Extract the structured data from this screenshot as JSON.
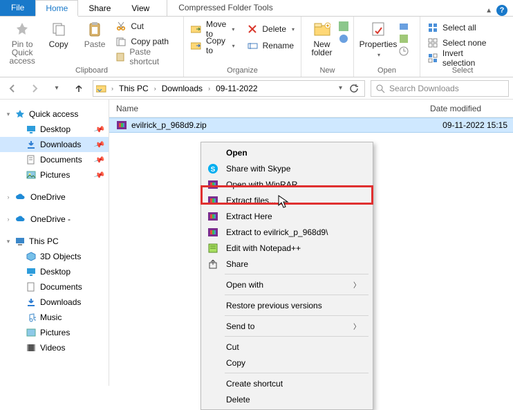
{
  "tabs": {
    "file": "File",
    "home": "Home",
    "share": "Share",
    "view": "View",
    "tools": "Compressed Folder Tools"
  },
  "ribbon": {
    "clipboard": {
      "label": "Clipboard",
      "pin": "Pin to Quick access",
      "copy": "Copy",
      "paste": "Paste",
      "cut": "Cut",
      "copy_path": "Copy path",
      "paste_shortcut": "Paste shortcut"
    },
    "organize": {
      "label": "Organize",
      "move_to": "Move to",
      "copy_to": "Copy to",
      "delete": "Delete",
      "rename": "Rename"
    },
    "new_": {
      "label": "New",
      "new_folder": "New folder"
    },
    "open": {
      "label": "Open",
      "properties": "Properties"
    },
    "select": {
      "label": "Select",
      "select_all": "Select all",
      "select_none": "Select none",
      "invert": "Invert selection"
    }
  },
  "breadcrumb": {
    "root": "This PC",
    "lvl1": "Downloads",
    "lvl2": "09-11-2022"
  },
  "search": {
    "placeholder": "Search Downloads"
  },
  "columns": {
    "name": "Name",
    "date": "Date modified"
  },
  "file": {
    "name": "evilrick_p_968d9.zip",
    "date": "09-11-2022 15:15"
  },
  "nav": {
    "quick_access": "Quick access",
    "desktop": "Desktop",
    "downloads": "Downloads",
    "documents": "Documents",
    "pictures": "Pictures",
    "onedrive1": "OneDrive",
    "onedrive2": "OneDrive -",
    "this_pc": "This PC",
    "objects3d": "3D Objects",
    "desktop2": "Desktop",
    "documents2": "Documents",
    "downloads2": "Downloads",
    "music": "Music",
    "pictures2": "Pictures",
    "videos": "Videos"
  },
  "ctx": {
    "open": "Open",
    "skype": "Share with Skype",
    "open_winrar": "Open with WinRAR",
    "extract_files": "Extract files...",
    "extract_here": "Extract Here",
    "extract_to": "Extract to evilrick_p_968d9\\",
    "notepadpp": "Edit with Notepad++",
    "share": "Share",
    "open_with": "Open with",
    "restore": "Restore previous versions",
    "send_to": "Send to",
    "cut": "Cut",
    "copy": "Copy",
    "create_shortcut": "Create shortcut",
    "delete": "Delete"
  }
}
